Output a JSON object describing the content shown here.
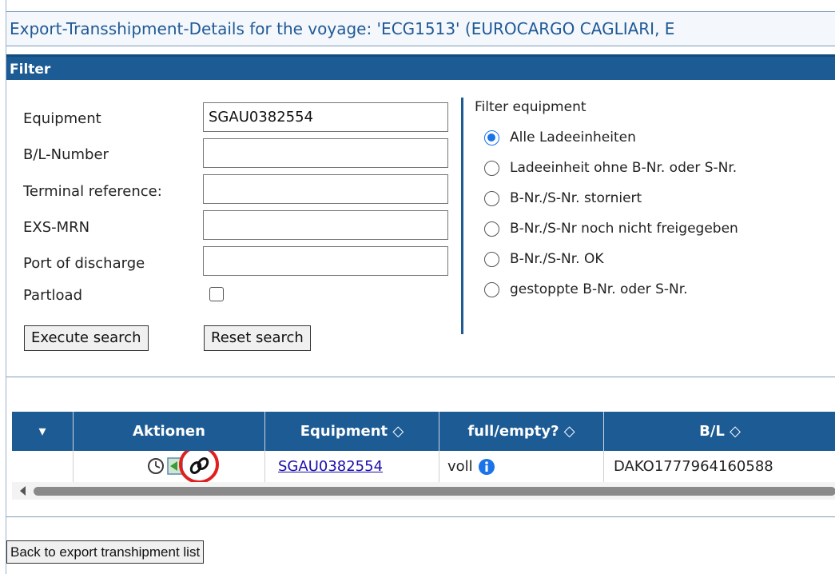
{
  "title": "Export-Transshipment-Details for the voyage: 'ECG1513' (EUROCARGO CAGLIARI, E",
  "filter": {
    "header": "Filter",
    "labels": {
      "equipment": "Equipment",
      "bl_number": "B/L-Number",
      "terminal_reference": "Terminal reference:",
      "exs_mrn": "EXS-MRN",
      "port_of_discharge": "Port of discharge",
      "partload": "Partload"
    },
    "values": {
      "equipment": "SGAU0382554",
      "bl_number": "",
      "terminal_reference": "",
      "exs_mrn": "",
      "port_of_discharge": ""
    },
    "partload_checked": false,
    "execute_label": "Execute search",
    "reset_label": "Reset search",
    "filter_equipment_title": "Filter equipment",
    "radio_options": [
      "Alle Ladeeinheiten",
      "Ladeeinheit ohne B-Nr. oder S-Nr.",
      "B-Nr./S-Nr. storniert",
      "B-Nr./S-Nr noch nicht freigegeben",
      "B-Nr./S-Nr. OK",
      "gestoppte B-Nr. oder S-Nr."
    ],
    "radio_selected": "Alle Ladeeinheiten"
  },
  "grid": {
    "headers": {
      "menu": "▾",
      "actions": "Aktionen",
      "equipment": "Equipment ◇",
      "full_empty": "full/empty? ◇",
      "bl": "B/L ◇"
    },
    "row": {
      "equipment": "SGAU0382554",
      "full_empty": "voll",
      "bl": "DAKO1777964160588"
    }
  },
  "back_label": "Back to export transhipment list",
  "colors": {
    "header_blue": "#1d5b94",
    "title_text": "#1f5a96",
    "highlight_circle": "#e02020"
  }
}
